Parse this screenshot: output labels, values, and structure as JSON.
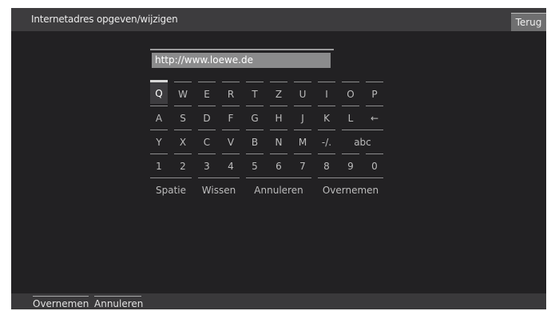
{
  "header": {
    "title": "Internetadres opgeven/wijzigen",
    "back_label": "Terug"
  },
  "url_field": {
    "value": "http://www.loewe.de"
  },
  "keyboard": {
    "selected_key": "Q",
    "row1": [
      "Q",
      "W",
      "E",
      "R",
      "T",
      "Z",
      "U",
      "I",
      "O",
      "P"
    ],
    "row2": [
      "A",
      "S",
      "D",
      "F",
      "G",
      "H",
      "J",
      "K",
      "L",
      "←"
    ],
    "row3": [
      "Y",
      "X",
      "C",
      "V",
      "B",
      "N",
      "M",
      "-/.",
      "abc"
    ],
    "row4": [
      "1",
      "2",
      "3",
      "4",
      "5",
      "6",
      "7",
      "8",
      "9",
      "0"
    ],
    "row5": [
      "Spatie",
      "Wissen",
      "Annuleren",
      "Overnemen"
    ]
  },
  "footer": {
    "buttons": [
      "Overnemen",
      "Annuleren"
    ]
  }
}
